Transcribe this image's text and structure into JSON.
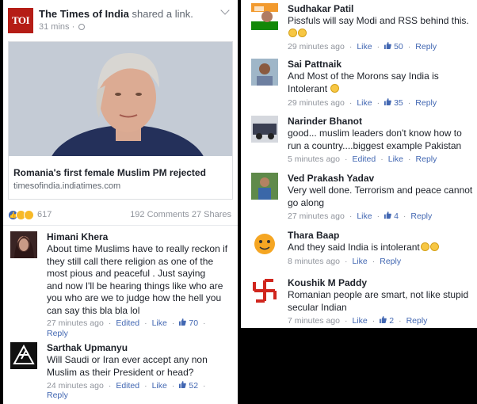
{
  "post": {
    "page_name": "The Times of India",
    "action": " shared a link.",
    "logo_text": "TOI",
    "time": "31 mins",
    "link_title": "Romania's first female Muslim PM rejected",
    "link_domain": "timesofindia.indiatimes.com",
    "reaction_count": "617",
    "comments_count": "192 Comments",
    "shares_count": "27 Shares"
  },
  "left_comments": [
    {
      "name": "Himani Khera",
      "text": "About time Muslims have to really reckon if\nthey still call there religion as one of the\nmost pious and peaceful . Just saying \nand now I'll be hearing things like who are\nyou who are we to judge how the hell you\ncan say this bla bla lol ",
      "time": "27 minutes ago",
      "edited": "Edited",
      "like": "Like",
      "likes": "70",
      "reply": "Reply"
    },
    {
      "name": "Sarthak Upmanyu",
      "text": "Will Saudi or Iran ever accept any non\nMuslim as their President or head?",
      "time": "24 minutes ago",
      "edited": "Edited",
      "like": "Like",
      "likes": "52",
      "reply": "Reply"
    }
  ],
  "right_comments": [
    {
      "name": "Sudhakar Patil",
      "text": "Pissfuls will say Modi and RSS behind this.",
      "time": "29 minutes ago",
      "like": "Like",
      "likes": "50",
      "reply": "Reply"
    },
    {
      "name": "Sai Pattnaik",
      "text": "And Most of the Morons say India is\nIntolerant ",
      "time": "29 minutes ago",
      "like": "Like",
      "likes": "35",
      "reply": "Reply"
    },
    {
      "name": "Narinder Bhanot",
      "text": "good... muslim leaders don't know how to\nrun a country....biggest example Pakistan",
      "time": "5 minutes ago",
      "edited": "Edited",
      "like": "Like",
      "reply": "Reply"
    },
    {
      "name": "Ved Prakash Yadav",
      "text": "Very well done. Terrorism and peace cannot\ngo along",
      "time": "27 minutes ago",
      "like": "Like",
      "likes": "4",
      "reply": "Reply"
    },
    {
      "name": "Thara Baap",
      "text": "And they said India is intolerant",
      "time": "8 minutes ago",
      "like": "Like",
      "reply": "Reply"
    },
    {
      "name": "Koushik M Paddy",
      "text": "Romanian people are smart, not like stupid\nsecular Indian",
      "time": "7 minutes ago",
      "like": "Like",
      "likes": "2",
      "reply": "Reply"
    }
  ],
  "colors": {
    "link_blue": "#4267b2",
    "meta_grey": "#90949c",
    "toi_red": "#b51d16"
  }
}
